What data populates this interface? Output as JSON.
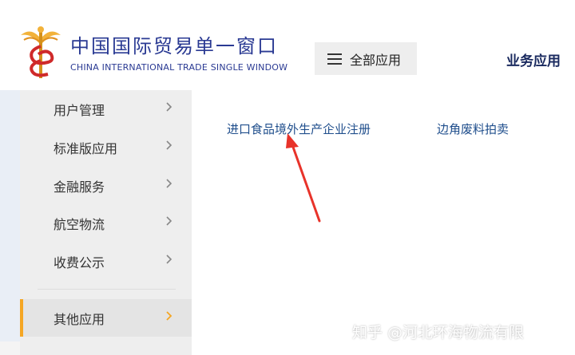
{
  "header": {
    "logo_title": "中国国际贸易单一窗口",
    "logo_subtitle": "CHINA INTERNATIONAL TRADE SINGLE WINDOW",
    "all_apps_label": "全部应用",
    "biz_apps_label": "业务应用"
  },
  "sidebar": {
    "items": [
      {
        "label": "用户管理"
      },
      {
        "label": "标准版应用"
      },
      {
        "label": "金融服务"
      },
      {
        "label": "航空物流"
      },
      {
        "label": "收费公示"
      },
      {
        "label": "其他应用",
        "active": true
      }
    ]
  },
  "main": {
    "apps": [
      {
        "label": "进口食品境外生产企业注册"
      },
      {
        "label": "边角废料拍卖"
      }
    ]
  },
  "watermark": "知乎 @河北环海物流有限",
  "colors": {
    "brand_blue": "#2a3a93",
    "link_blue": "#1f4e8c",
    "accent_orange": "#f5a623",
    "annotation_red": "#e8332a"
  },
  "icons": [
    "logo-caduceus-icon",
    "menu-icon",
    "chevron-right-icon",
    "red-arrow-annotation"
  ]
}
